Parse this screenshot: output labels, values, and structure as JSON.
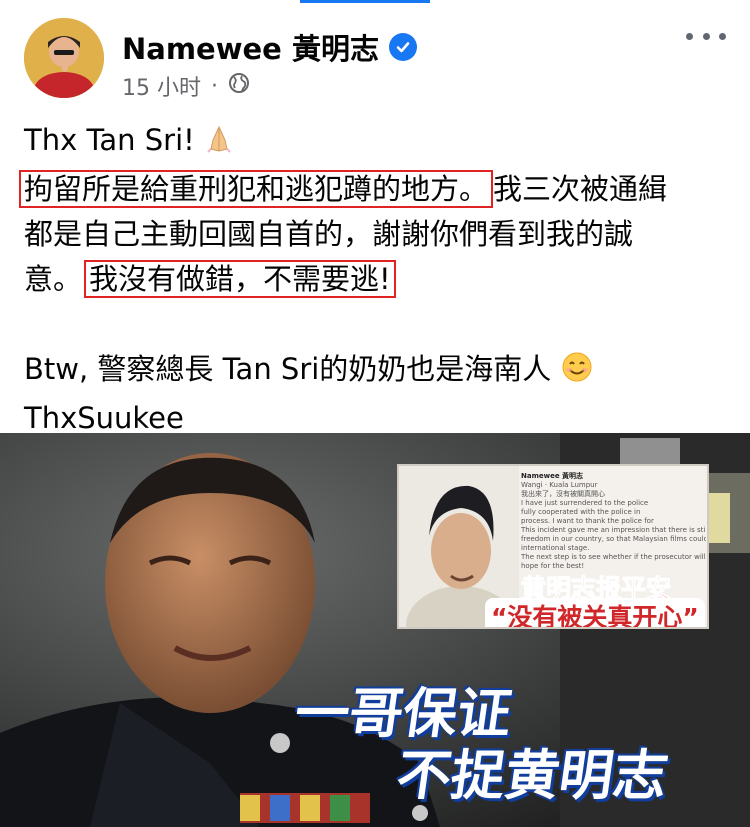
{
  "post": {
    "author": "Namewee 黃明志",
    "timestamp": "15 小时",
    "more_icon": "more-horizontal-icon",
    "privacy_icon": "globe-icon",
    "verified_icon": "verified-badge-icon",
    "accent_color": "#1877f2",
    "highlight_color": "#e02424"
  },
  "text": {
    "line1": "Thx Tan Sri!",
    "line1_emoji": "folded-hands-emoji",
    "line2_highlight": "拘留所是給重刑犯和逃犯蹲的地方。",
    "line2_rest": "我三次被通緝",
    "line3": "都是自己主動回國自首的，謝謝你們看到我的誠",
    "line4_start": "意。",
    "line4_highlight": "我沒有做錯，不需要逃!",
    "line5": "Btw, 警察總長 Tan Sri的奶奶也是海南人",
    "line5_emoji": "smiling-face-emoji",
    "line6": "ThxSuukee"
  },
  "image": {
    "caption_line1": "一哥保证",
    "caption_line2": "不捉黄明志",
    "inset": {
      "header": "Namewee 黃明志",
      "sub": "Wangi · Kuala Lumpur",
      "body": [
        "我出來了，沒有被關真開心",
        "I have just surrendered to the police",
        "fully cooperated with the police in",
        "process. I want to thank the police for",
        "This incident gave me an impression that there is still hope for artistic",
        "freedom in our country, so that Malaysian films could compete on the",
        "international stage.",
        "The next step is to see whether if the prosecutor will sue me. Let's",
        "hope for the best!"
      ],
      "caption1": "黄明志报平安",
      "caption2": "“没有被关真开心”"
    }
  }
}
